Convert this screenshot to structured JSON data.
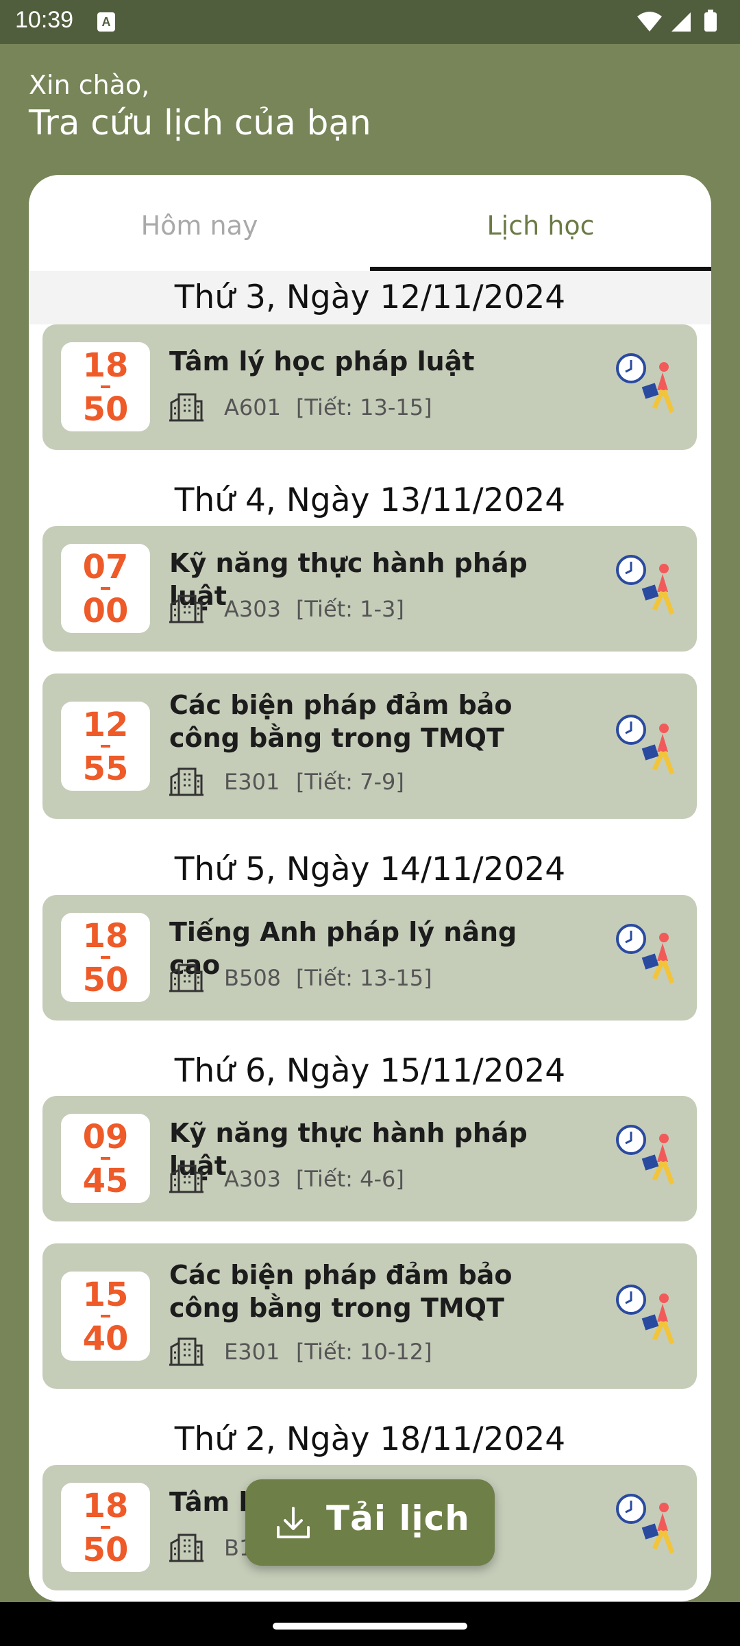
{
  "status_bar": {
    "time": "10:39",
    "notif_letter": "A"
  },
  "header": {
    "greeting": "Xin chào,",
    "title": "Tra cứu lịch của bạn"
  },
  "tabs": [
    {
      "label": "Hôm nay",
      "selected": false
    },
    {
      "label": "Lịch học",
      "selected": true
    }
  ],
  "days": [
    {
      "header": "Thứ 3, Ngày 12/11/2024",
      "items": [
        {
          "start": "18",
          "end": "50",
          "subject": "Tâm lý học pháp luật",
          "room": "A601",
          "period": "[Tiết: 13-15]"
        }
      ]
    },
    {
      "header": "Thứ 4, Ngày 13/11/2024",
      "items": [
        {
          "start": "07",
          "end": "00",
          "subject": "Kỹ năng thực hành pháp luật",
          "room": "A303",
          "period": "[Tiết: 1-3]"
        },
        {
          "start": "12",
          "end": "55",
          "subject": "Các biện pháp đảm bảo công bằng trong TMQT",
          "room": "E301",
          "period": "[Tiết: 7-9]"
        }
      ]
    },
    {
      "header": "Thứ 5, Ngày 14/11/2024",
      "items": [
        {
          "start": "18",
          "end": "50",
          "subject": "Tiếng Anh pháp lý nâng cao",
          "room": "B508",
          "period": "[Tiết: 13-15]"
        }
      ]
    },
    {
      "header": "Thứ 6, Ngày 15/11/2024",
      "items": [
        {
          "start": "09",
          "end": "45",
          "subject": "Kỹ năng thực hành pháp luật",
          "room": "A303",
          "period": "[Tiết: 4-6]"
        },
        {
          "start": "15",
          "end": "40",
          "subject": "Các biện pháp đảm bảo công bằng trong TMQT",
          "room": "E301",
          "period": "[Tiết: 10-12]"
        }
      ]
    },
    {
      "header": "Thứ 2, Ngày 18/11/2024",
      "items": [
        {
          "start": "18",
          "end": "50",
          "subject": "Tâm lý",
          "room": "B1",
          "period": ""
        }
      ]
    }
  ],
  "fab": {
    "label": "Tải lịch",
    "icon": "download-icon"
  },
  "colors": {
    "background": "#778558",
    "item_bg": "#c5cdb9",
    "time_orange": "#ee5a28",
    "tab_active": "#6b7a45",
    "fab": "#6f7f48"
  }
}
